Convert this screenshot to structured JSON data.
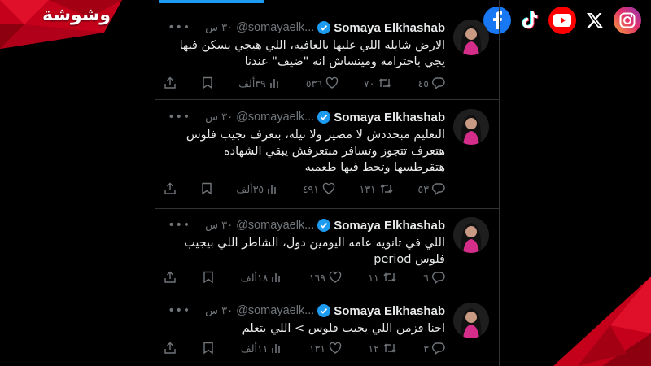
{
  "brand": {
    "logo_text": "وشوشة",
    "accent_color": "#d6001c"
  },
  "social_icons": [
    {
      "name": "facebook-icon",
      "color": "#1877f2"
    },
    {
      "name": "tiktok-icon",
      "color": "#000000"
    },
    {
      "name": "youtube-icon",
      "color": "#ff0000"
    },
    {
      "name": "x-icon",
      "color": "#000000"
    },
    {
      "name": "instagram-icon",
      "color": "#e1306c"
    }
  ],
  "tweets": [
    {
      "name": "Somaya Elkhashab",
      "handle": "@somayaelk...",
      "time": "٣٠ س",
      "text": "الارض شايله اللي عليها بالعافيه، اللي هيجي يسكن فيها يجي باحترامه وميتساش انه \"ضيف\" عندنا",
      "replies": "٤٥",
      "retweets": "٧٠",
      "likes": "٥٣٦",
      "views": "٣٩ألف"
    },
    {
      "name": "Somaya Elkhashab",
      "handle": "@somayaelk...",
      "time": "٣٠ س",
      "text": "التعليم مبحددش لا مصير ولا نيله، بتعرف تجيب فلوس هتعرف تتجوز وتسافر مبتعرفش يبقي الشهاده هتقرطسها وتحط فيها طعميه",
      "replies": "٥٣",
      "retweets": "١٣١",
      "likes": "٤٩١",
      "views": "٣٥ألف"
    },
    {
      "name": "Somaya Elkhashab",
      "handle": "@somayaelk...",
      "time": "٣٠ س",
      "text": "اللي في ثانويه عامه اليومين دول، الشاطر اللي بيجيب فلوس period",
      "replies": "٦",
      "retweets": "١١",
      "likes": "١٦٩",
      "views": "١٨ألف"
    },
    {
      "name": "Somaya Elkhashab",
      "handle": "@somayaelk...",
      "time": "٣٠ س",
      "text": "احنا فزمن اللي يجيب فلوس > اللي يتعلم",
      "replies": "٣",
      "retweets": "١٢",
      "likes": "١٣١",
      "views": "١١ألف"
    }
  ]
}
